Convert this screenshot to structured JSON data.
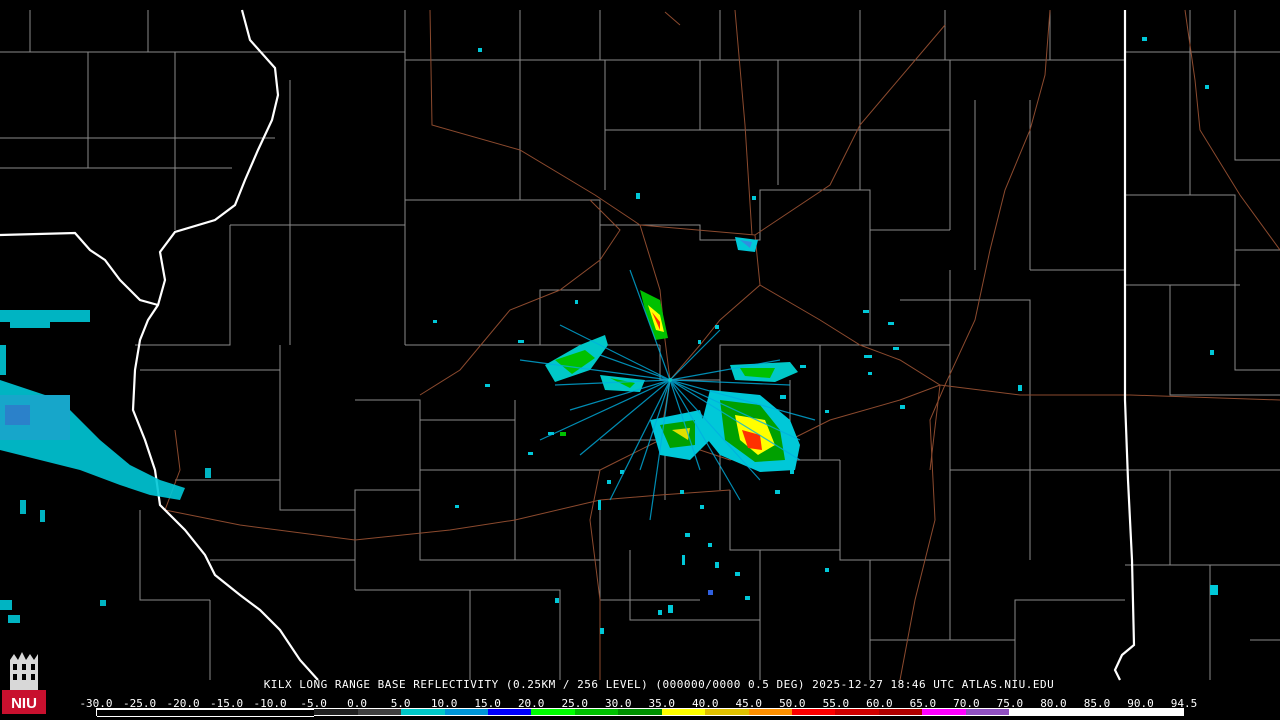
{
  "radar": {
    "caption": "KILX LONG RANGE BASE REFLECTIVITY (0.25KM / 256 LEVEL) (000000/0000 0.5 DEG) 2025-12-27 18:46 UTC  ATLAS.NIU.EDU",
    "station": "KILX",
    "product": "LONG RANGE BASE REFLECTIVITY",
    "timestamp": "2025-12-27 18:46 UTC",
    "source": "ATLAS.NIU.EDU"
  },
  "logo": {
    "text": "NIU",
    "icon": "niu-tower-logo-icon",
    "color": "#c8102e"
  },
  "scale": {
    "ticks": [
      "-30.0",
      "-25.0",
      "-20.0",
      "-15.0",
      "-10.0",
      "-5.0",
      "0.0",
      "5.0",
      "10.0",
      "15.0",
      "20.0",
      "25.0",
      "30.0",
      "35.0",
      "40.0",
      "45.0",
      "50.0",
      "55.0",
      "60.0",
      "65.0",
      "70.0",
      "75.0",
      "80.0",
      "85.0",
      "90.0",
      "94.5"
    ],
    "colors": [
      "#000000",
      "#000000",
      "#000000",
      "#000000",
      "#000000",
      "#202020",
      "#404040",
      "#00c8c8",
      "#0096d8",
      "#0000ff",
      "#00ff00",
      "#00c000",
      "#009000",
      "#ffff00",
      "#e0c000",
      "#ff9000",
      "#ff0000",
      "#d00000",
      "#b00000",
      "#ff00ff",
      "#9050c0",
      "#ffffff",
      "#ffffff",
      "#ffffff",
      "#ffffff"
    ]
  }
}
